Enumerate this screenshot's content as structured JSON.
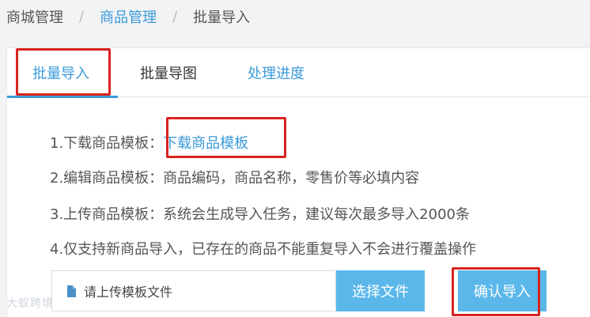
{
  "breadcrumb": {
    "items": [
      "商城管理",
      "商品管理",
      "批量导入"
    ],
    "separator": "/"
  },
  "tabs": [
    {
      "label": "批量导入",
      "active": true
    },
    {
      "label": "批量导图",
      "active": false
    },
    {
      "label": "处理进度",
      "active": false
    }
  ],
  "steps": {
    "step1_prefix": "1.下载商品模板：",
    "step1_link": "下载商品模板",
    "step2": "2.编辑商品模板：商品编码，商品名称，零售价等必填内容",
    "step3": "3.上传商品模板：系统会生成导入任务，建议每次最多导入2000条",
    "step4": "4.仅支持新商品导入，已存在的商品不能重复导入不会进行覆盖操作"
  },
  "upload": {
    "file_placeholder": "请上传模板文件",
    "choose_button": "选择文件",
    "confirm_button": "确认导入",
    "file_icon": "file-icon"
  },
  "watermark": "大蚁跨境",
  "colors": {
    "accent": "#3a9ad9",
    "button": "#5bb7ea",
    "highlight_box": "#d9231f"
  }
}
